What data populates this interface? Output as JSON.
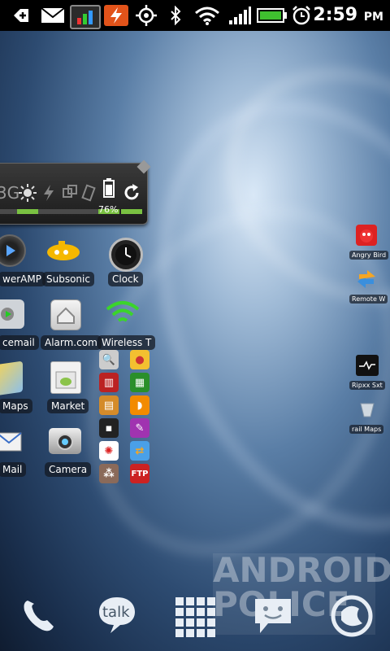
{
  "status_bar": {
    "time": "2:59",
    "ampm": "PM",
    "icons": [
      "add-icon",
      "mail-icon",
      "chart-widget-icon",
      "flash-icon",
      "gps-icon",
      "bluetooth-icon",
      "wifi-icon",
      "signal-icon",
      "battery-icon",
      "alarm-icon"
    ]
  },
  "toggle_widget": {
    "battery_percent": "76%",
    "cells": [
      "3g-icon",
      "brightness-icon",
      "flash-icon",
      "sync-icon",
      "rotate-icon",
      "battery-icon",
      "refresh-icon"
    ]
  },
  "apps": {
    "poweramp": "werAMP",
    "subsonic": "Subsonic",
    "clock": "Clock",
    "voicemail": "cemail",
    "alarm": "Alarm.com",
    "wireless": "Wireless T",
    "maps": "Maps",
    "market": "Market",
    "mail": "Mail",
    "camera": "Camera"
  },
  "right_shortcuts": {
    "angry_birds": "Angry Bird",
    "remote": "Remote W",
    "ripple": "Ripxx Sxt",
    "trail_maps": "rail Maps"
  },
  "dock": {
    "talk": "talk"
  },
  "watermark": {
    "line1": "ANDROID",
    "line2": "POLICE"
  }
}
